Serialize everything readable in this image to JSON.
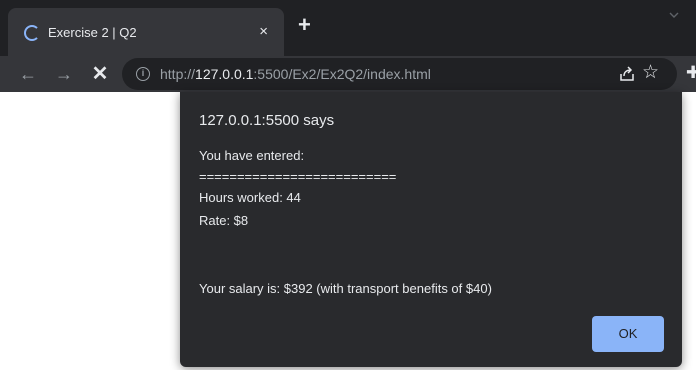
{
  "tab": {
    "title": "Exercise 2 | Q2",
    "close": "×"
  },
  "toolbar": {
    "back": "←",
    "forward": "→",
    "stop": "✕",
    "url_scheme": "http://",
    "url_host": "127.0.0.1",
    "url_rest": ":5500/Ex2/Ex2Q2/index.html"
  },
  "dialog": {
    "title": "127.0.0.1:5500 says",
    "lines": [
      "You have entered:",
      "==========================",
      "Hours worked: 44",
      "Rate: $8",
      "Your salary is: $392 (with transport benefits of $40)"
    ],
    "ok_label": "OK"
  },
  "colors": {
    "accent": "#8ab4f8",
    "chrome_dark": "#202124",
    "chrome_mid": "#35363a",
    "dialog_bg": "#292a2d"
  }
}
